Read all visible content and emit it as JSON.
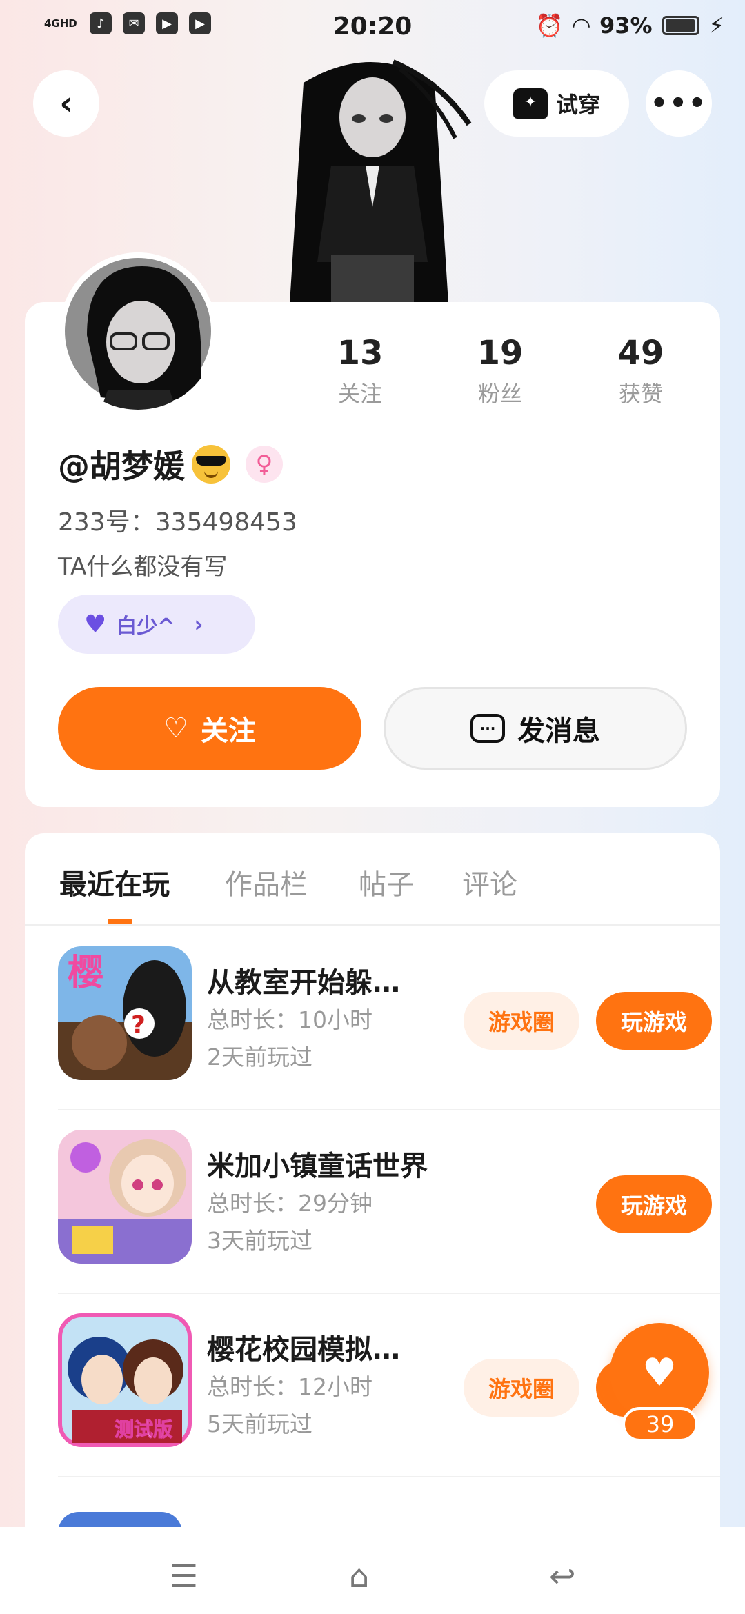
{
  "status_bar": {
    "network": "4GHD",
    "time": "20:20",
    "battery": "93%"
  },
  "header": {
    "try_on_label": "试穿"
  },
  "profile": {
    "nickname": "@胡梦媛",
    "uid": "233号：335498453",
    "bio": "TA什么都没有写",
    "tag": "白少^",
    "stats": [
      {
        "value": "13",
        "label": "关注"
      },
      {
        "value": "19",
        "label": "粉丝"
      },
      {
        "value": "49",
        "label": "获赞"
      }
    ],
    "follow_label": "关注",
    "message_label": "发消息"
  },
  "tabs": [
    "最近在玩",
    "作品栏",
    "帖子",
    "评论"
  ],
  "games": [
    {
      "title": "从教室开始躲…",
      "duration": "总时长：10小时",
      "last_played": "2天前玩过",
      "circle_label": "游戏圈",
      "play_label": "玩游戏"
    },
    {
      "title": "米加小镇童话世界",
      "duration": "总时长：29分钟",
      "last_played": "3天前玩过",
      "play_label": "玩游戏"
    },
    {
      "title": "樱花校园模拟…",
      "duration": "总时长：12小时",
      "last_played": "5天前玩过",
      "circle_label": "游戏圈",
      "play_label": "玩"
    }
  ],
  "game_icon_text": {
    "g1": "樱",
    "g3": "测试版"
  },
  "like_count": "39",
  "colors": {
    "accent": "#ff7311",
    "tag_bg": "#ece9fc"
  }
}
